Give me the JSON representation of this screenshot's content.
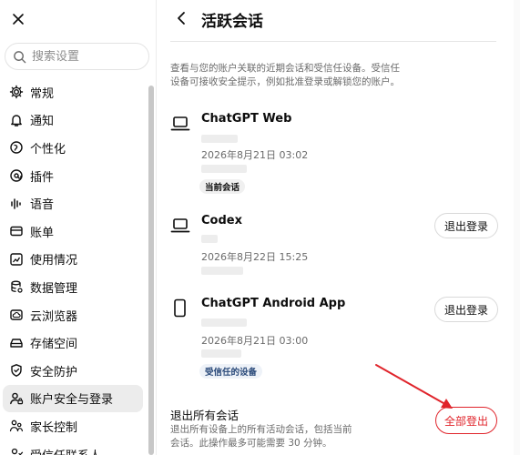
{
  "sidebar": {
    "search_placeholder": "搜索设置",
    "items": [
      {
        "label": "常规",
        "icon": "gear-icon"
      },
      {
        "label": "通知",
        "icon": "bell-icon"
      },
      {
        "label": "个性化",
        "icon": "personalize-icon"
      },
      {
        "label": "插件",
        "icon": "plugin-icon"
      },
      {
        "label": "语音",
        "icon": "waveform-icon"
      },
      {
        "label": "账单",
        "icon": "billing-icon"
      },
      {
        "label": "使用情况",
        "icon": "chart-icon"
      },
      {
        "label": "数据管理",
        "icon": "database-icon"
      },
      {
        "label": "云浏览器",
        "icon": "cloud-browser-icon"
      },
      {
        "label": "存储空间",
        "icon": "storage-icon"
      },
      {
        "label": "安全防护",
        "icon": "shield-icon"
      },
      {
        "label": "账户安全与登录",
        "icon": "user-lock-icon",
        "active": true
      },
      {
        "label": "家长控制",
        "icon": "family-icon"
      },
      {
        "label": "受信任联系人",
        "icon": "contact-icon"
      }
    ]
  },
  "main": {
    "title": "活跃会话",
    "description": "查看与您的账户关联的近期会话和受信任设备。受信任设备可接收安全提示，例如批准登录或解锁您的账户。",
    "sessions": [
      {
        "name": "ChatGPT Web",
        "icon": "laptop-icon",
        "date": "2026年8月21日 03:02",
        "badge": "当前会话"
      },
      {
        "name": "Codex",
        "icon": "laptop-icon",
        "date": "2026年8月22日 15:25",
        "action": "退出登录"
      },
      {
        "name": "ChatGPT Android App",
        "icon": "phone-icon",
        "date": "2026年8月21日 03:00",
        "badge": "受信任的设备",
        "action": "退出登录"
      }
    ],
    "logout_all": {
      "title": "退出所有会话",
      "description": "退出所有设备上的所有活动会话，包括当前会话。此操作最多可能需要 30 分钟。",
      "button": "全部登出"
    }
  },
  "colors": {
    "danger": "#e0242b",
    "active_bg": "#ececec"
  }
}
